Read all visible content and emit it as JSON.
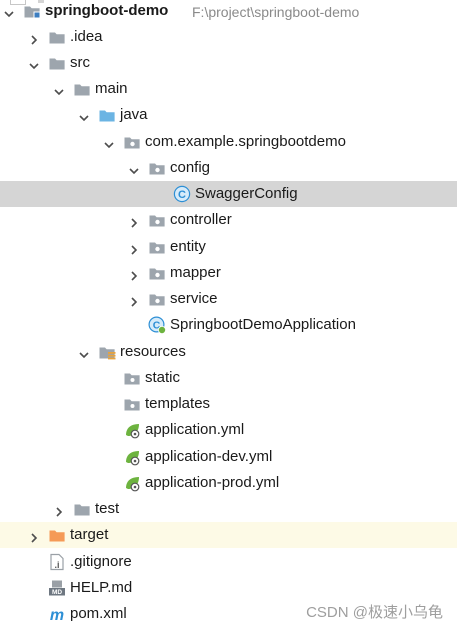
{
  "project_tree": {
    "rows": [
      {
        "label": "springboot-demo",
        "path": "F:\\project\\springboot-demo",
        "icon": "module-folder-icon",
        "arrow": "expanded",
        "bold": true
      },
      {
        "label": ".idea",
        "icon": "folder-icon",
        "arrow": "collapsed"
      },
      {
        "label": "src",
        "icon": "folder-icon",
        "arrow": "expanded"
      },
      {
        "label": "main",
        "icon": "folder-icon",
        "arrow": "expanded"
      },
      {
        "label": "java",
        "icon": "source-root-folder-icon",
        "arrow": "expanded"
      },
      {
        "label": "com.example.springbootdemo",
        "icon": "package-icon",
        "arrow": "expanded"
      },
      {
        "label": "config",
        "icon": "package-icon",
        "arrow": "expanded"
      },
      {
        "label": "SwaggerConfig",
        "icon": "java-class-icon",
        "arrow": "none",
        "selected": true
      },
      {
        "label": "controller",
        "icon": "package-icon",
        "arrow": "collapsed"
      },
      {
        "label": "entity",
        "icon": "package-icon",
        "arrow": "collapsed"
      },
      {
        "label": "mapper",
        "icon": "package-icon",
        "arrow": "collapsed"
      },
      {
        "label": "service",
        "icon": "package-icon",
        "arrow": "collapsed"
      },
      {
        "label": "SpringbootDemoApplication",
        "icon": "spring-boot-class-icon",
        "arrow": "none"
      },
      {
        "label": "resources",
        "icon": "resources-root-folder-icon",
        "arrow": "expanded"
      },
      {
        "label": "static",
        "icon": "folder-dot-icon",
        "arrow": "none"
      },
      {
        "label": "templates",
        "icon": "folder-dot-icon",
        "arrow": "none"
      },
      {
        "label": "application.yml",
        "icon": "spring-yaml-icon",
        "arrow": "none"
      },
      {
        "label": "application-dev.yml",
        "icon": "spring-yaml-icon",
        "arrow": "none"
      },
      {
        "label": "application-prod.yml",
        "icon": "spring-yaml-icon",
        "arrow": "none"
      },
      {
        "label": "test",
        "icon": "folder-icon",
        "arrow": "collapsed"
      },
      {
        "label": "target",
        "icon": "excluded-folder-icon",
        "arrow": "collapsed",
        "excluded": true
      },
      {
        "label": ".gitignore",
        "icon": "gitignore-file-icon",
        "arrow": "none"
      },
      {
        "label": "HELP.md",
        "icon": "markdown-file-icon",
        "arrow": "none"
      },
      {
        "label": "pom.xml",
        "icon": "maven-pom-icon",
        "arrow": "none"
      }
    ]
  },
  "watermark": "CSDN @极速小乌龟",
  "colors": {
    "folder": "#9da5ad",
    "source_root": "#6bb4e3",
    "excluded_folder": "#f59a57",
    "class_badge": "#2d8fd5",
    "spring_green": "#6db33f",
    "selected_row": "#d5d5d5",
    "excluded_row": "#fdfae6",
    "path_text": "#8a8a8a"
  }
}
